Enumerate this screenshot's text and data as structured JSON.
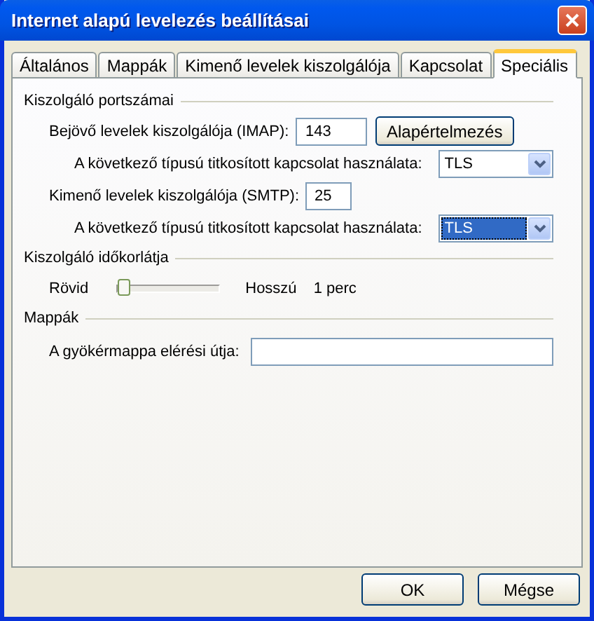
{
  "window": {
    "title": "Internet alapú levelezés beállításai"
  },
  "tabs": [
    {
      "label": "Általános",
      "selected": false
    },
    {
      "label": "Mappák",
      "selected": false
    },
    {
      "label": "Kimenő levelek kiszolgálója",
      "selected": false
    },
    {
      "label": "Kapcsolat",
      "selected": false
    },
    {
      "label": "Speciális",
      "selected": true
    }
  ],
  "sections": [
    {
      "title": "Kiszolgáló portszámai",
      "rows": [
        {
          "kind": "port",
          "label": "Bejövő levelek kiszolgálója (IMAP):",
          "value": "143",
          "button": "Alapértelmezés"
        },
        {
          "kind": "select",
          "label": "A következő típusú titkosított kapcsolat használata:",
          "value": "TLS",
          "focused": false
        },
        {
          "kind": "port",
          "label": "Kimenő levelek kiszolgálója (SMTP):",
          "value": "25"
        },
        {
          "kind": "select",
          "label": "A következő típusú titkosított kapcsolat használata:",
          "value": "TLS",
          "focused": true
        }
      ]
    },
    {
      "title": "Kiszolgáló időkorlátja",
      "rows": [
        {
          "kind": "slider",
          "min_label": "Rövid",
          "max_label": "Hosszú",
          "reading": "1 perc",
          "level": 0
        }
      ]
    },
    {
      "title": "Mappák",
      "rows": [
        {
          "kind": "path",
          "label": "A gyökérmappa elérési útja:"
        }
      ]
    }
  ],
  "buttons": [
    "OK",
    "Mégse"
  ]
}
